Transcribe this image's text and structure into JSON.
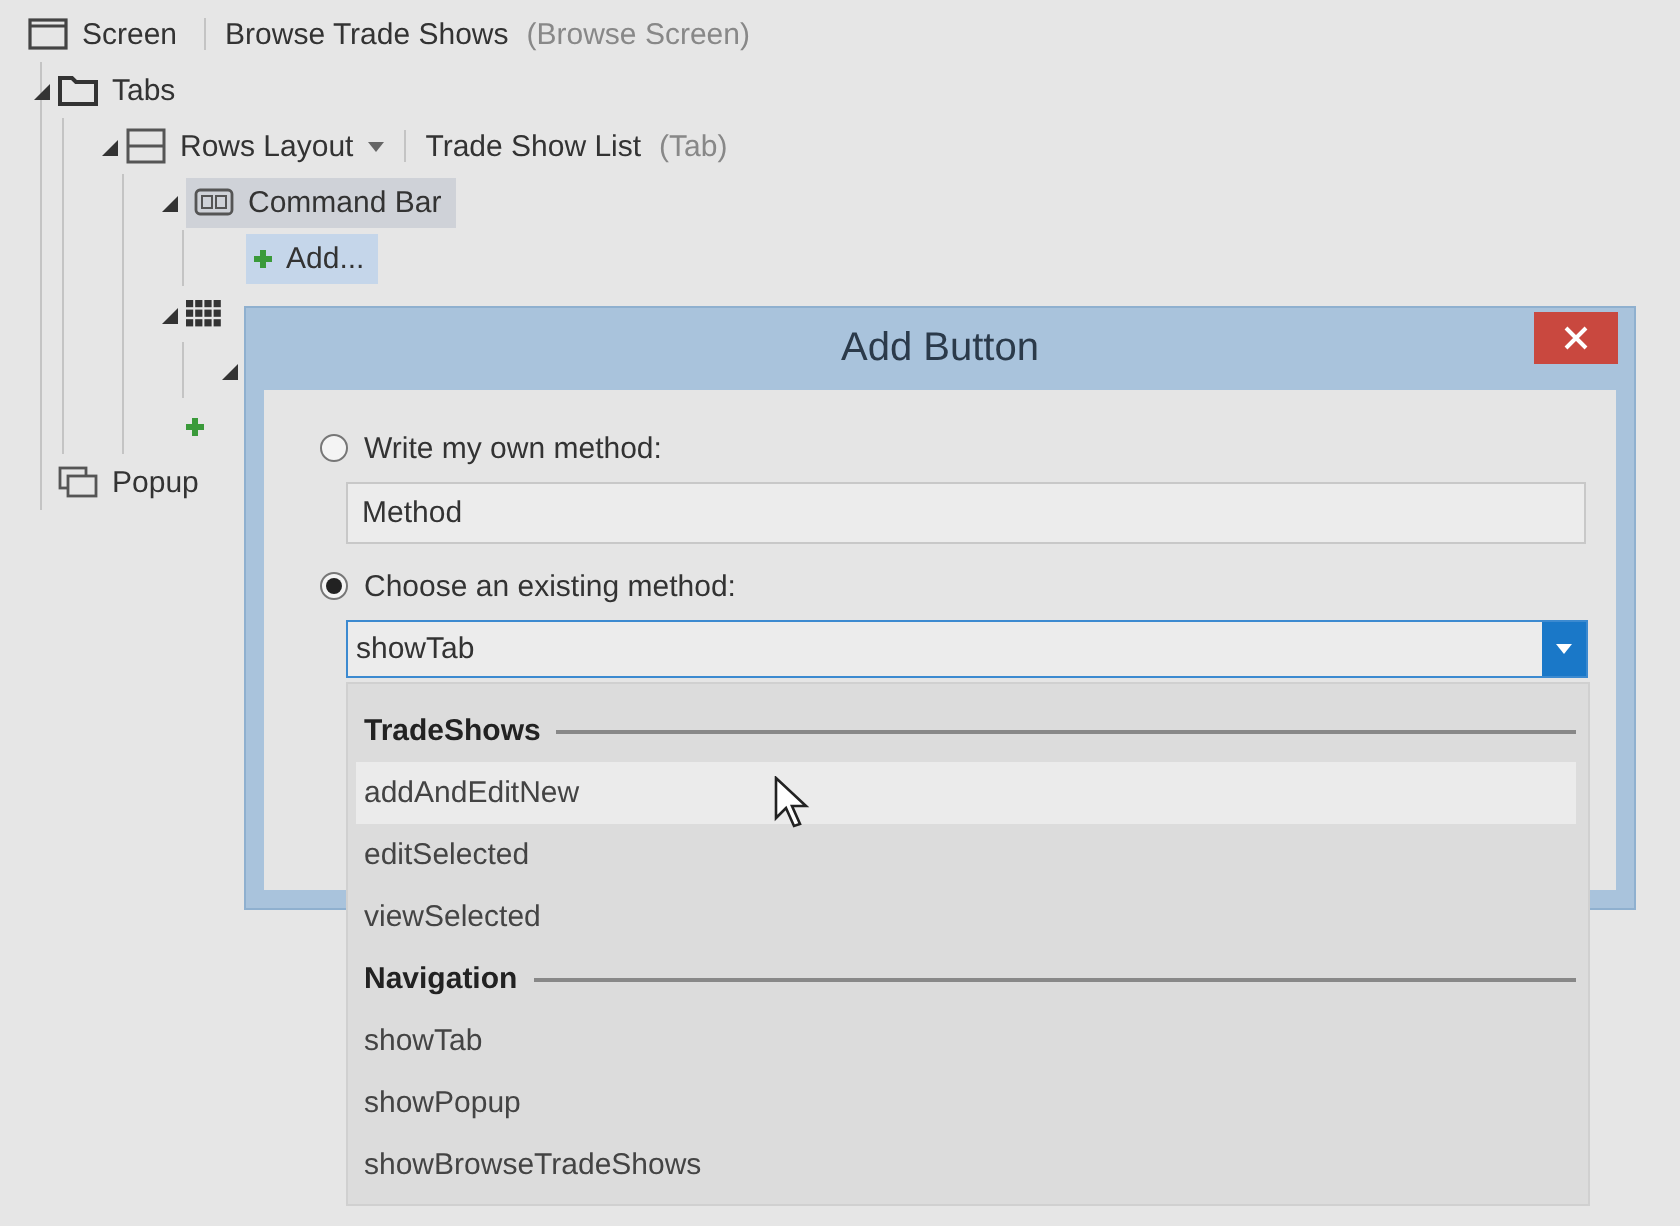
{
  "tree": [
    {
      "kind": "screen",
      "label": "Screen",
      "name": "Browse Trade Shows",
      "type": "(Browse Screen)",
      "selected": false,
      "highlighted": false,
      "children": [
        {
          "kind": "folder",
          "label": "Tabs",
          "expanded": true,
          "selected": false,
          "highlighted": false,
          "children": [
            {
              "kind": "rows",
              "label": "Rows Layout",
              "caret": true,
              "name": "Trade Show List",
              "type": "(Tab)",
              "expanded": true,
              "selected": false,
              "highlighted": false,
              "children": [
                {
                  "kind": "command-bar",
                  "label": "Command Bar",
                  "expanded": true,
                  "selected": false,
                  "highlighted": true,
                  "children": [
                    {
                      "kind": "plus",
                      "label": "Add...",
                      "selected": true,
                      "highlighted": false
                    }
                  ]
                },
                {
                  "kind": "grid",
                  "expanded": true,
                  "selected": false,
                  "highlighted": false,
                  "children": [
                    {
                      "expanded": true
                    }
                  ]
                },
                {
                  "kind": "plus",
                  "selected": false,
                  "highlighted": false
                }
              ]
            }
          ]
        },
        {
          "kind": "popups",
          "label": "Popup",
          "selected": false,
          "highlighted": false
        }
      ]
    }
  ],
  "dialog": {
    "title": "Add Button",
    "options": [
      {
        "kind": "text",
        "label": "Write my own method:",
        "selected": false,
        "value": "Method"
      },
      {
        "kind": "combo",
        "label": "Choose an existing method:",
        "selected": true,
        "value": "showTab",
        "expanded": true
      }
    ],
    "dropdown": [
      {
        "header": "TradeShows",
        "items": [
          {
            "label": "addAndEditNew",
            "selected": true
          },
          {
            "label": "editSelected",
            "selected": false
          },
          {
            "label": "viewSelected",
            "selected": false
          }
        ]
      },
      {
        "header": "Navigation",
        "items": [
          {
            "label": "showTab",
            "selected": false
          },
          {
            "label": "showPopup",
            "selected": false
          },
          {
            "label": "showBrowseTradeShows",
            "selected": false
          }
        ]
      }
    ]
  }
}
